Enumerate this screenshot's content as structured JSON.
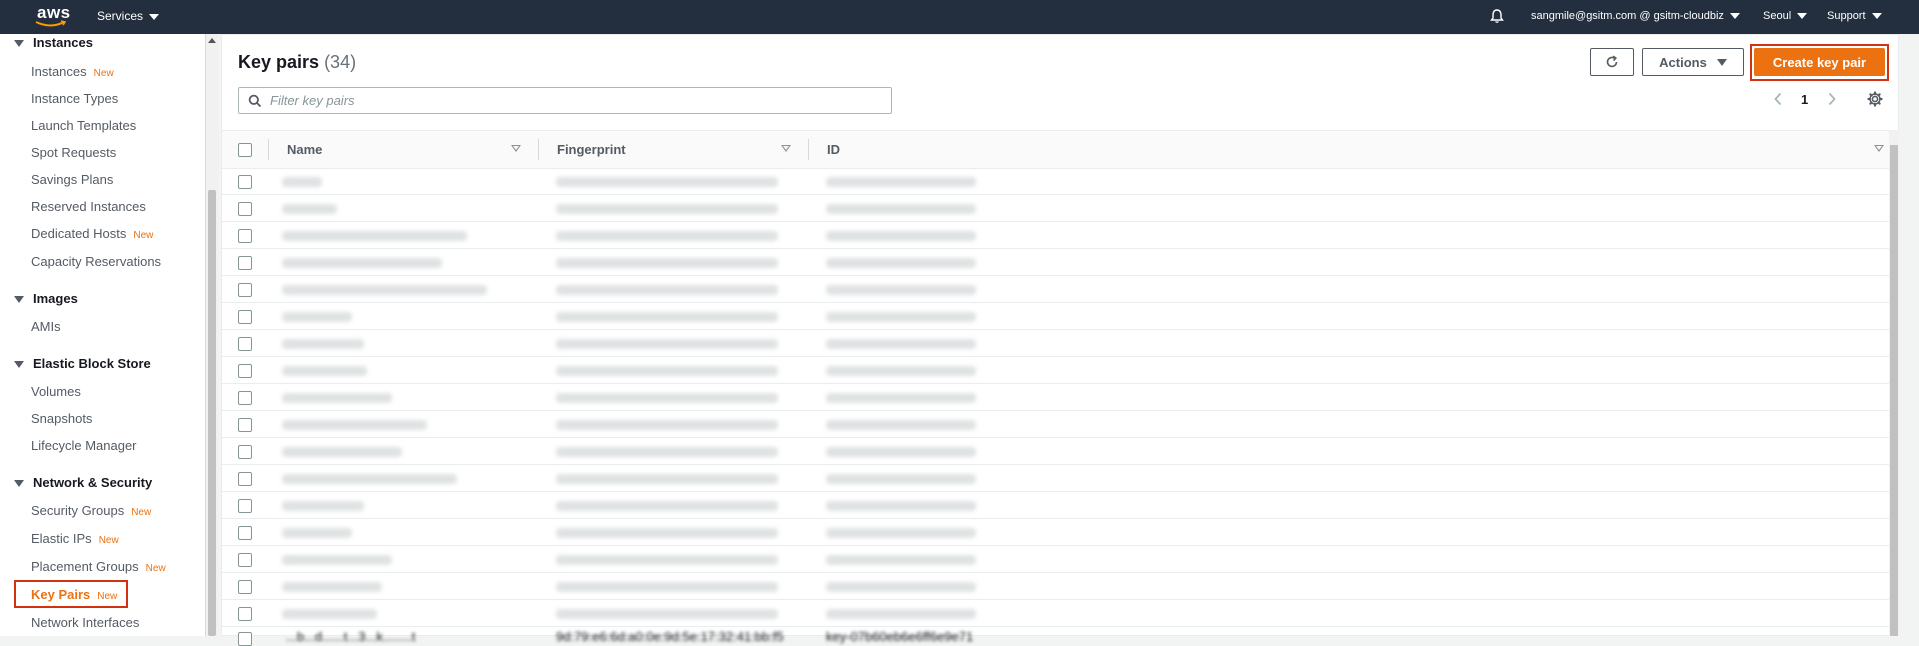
{
  "topnav": {
    "logo_text": "aws",
    "services": "Services",
    "account": "sangmile@gsitm.com @ gsitm-cloudbiz",
    "region": "Seoul",
    "support": "Support"
  },
  "sidebar": {
    "new_badge": "New",
    "sections": [
      {
        "title": "Instances",
        "items": [
          {
            "label": "Instances",
            "new": true
          },
          {
            "label": "Instance Types",
            "new": false
          },
          {
            "label": "Launch Templates",
            "new": false
          },
          {
            "label": "Spot Requests",
            "new": false
          },
          {
            "label": "Savings Plans",
            "new": false
          },
          {
            "label": "Reserved Instances",
            "new": false
          },
          {
            "label": "Dedicated Hosts",
            "new": true
          },
          {
            "label": "Capacity Reservations",
            "new": false
          }
        ]
      },
      {
        "title": "Images",
        "items": [
          {
            "label": "AMIs",
            "new": false
          }
        ]
      },
      {
        "title": "Elastic Block Store",
        "items": [
          {
            "label": "Volumes",
            "new": false
          },
          {
            "label": "Snapshots",
            "new": false
          },
          {
            "label": "Lifecycle Manager",
            "new": false
          }
        ]
      },
      {
        "title": "Network & Security",
        "items": [
          {
            "label": "Security Groups",
            "new": true
          },
          {
            "label": "Elastic IPs",
            "new": true
          },
          {
            "label": "Placement Groups",
            "new": true
          },
          {
            "label": "Key Pairs",
            "new": true,
            "active": true
          },
          {
            "label": "Network Interfaces",
            "new": false
          }
        ]
      }
    ]
  },
  "main": {
    "title": "Key pairs",
    "count": "(34)",
    "actions_label": "Actions",
    "create_label": "Create key pair",
    "search_placeholder": "Filter key pairs",
    "page_number": "1",
    "columns": [
      "Name",
      "Fingerprint",
      "ID"
    ],
    "partial_last_row": {
      "name": "...b...d......t...3...k........t",
      "fingerprint": "9d:79:e6:6d:a0:0e:9d:5e:17:32:41:bb:f5",
      "id": "key-07b60eb6e6ff6e9e71"
    }
  },
  "colors": {
    "accent": "#ec7211",
    "nav_bg": "#232f3e",
    "highlight_border": "#d13212"
  }
}
